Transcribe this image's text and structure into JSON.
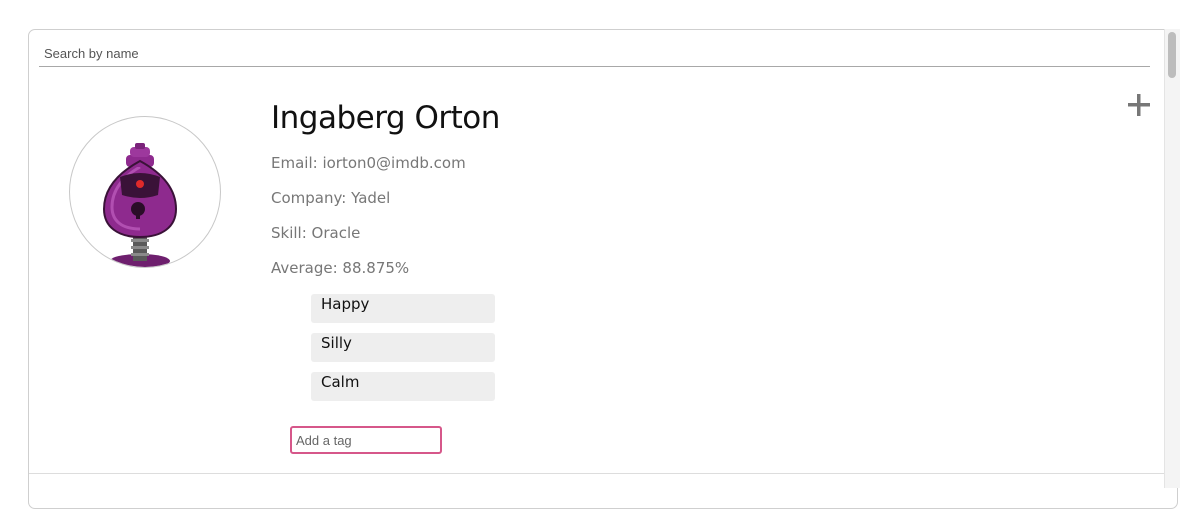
{
  "search": {
    "placeholder": "Search by name",
    "value": ""
  },
  "student": {
    "name": "Ingaberg Orton",
    "email_line": "Email: iorton0@imdb.com",
    "company_line": "Company: Yadel",
    "skill_line": "Skill: Oracle",
    "average_line": "Average: 88.875%",
    "avatar_icon": "purple-robot-avatar-icon",
    "tags": [
      "Happy",
      "Silly",
      "Calm"
    ],
    "tag_input": {
      "placeholder": "Add a tag",
      "value": ""
    },
    "expand_icon": "plus-icon"
  },
  "colors": {
    "tag_input_border": "#d6578a",
    "tag_background": "#eeeeee",
    "avatar_robot": "#8e2a8e"
  }
}
